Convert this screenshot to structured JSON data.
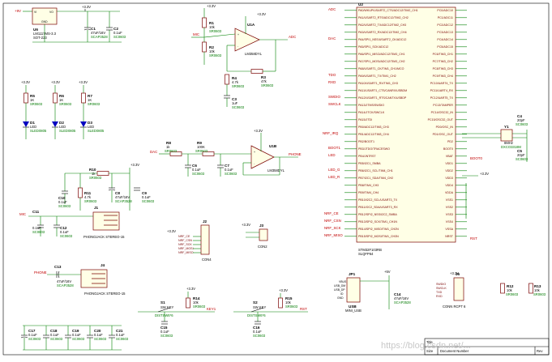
{
  "power": {
    "vin": "+9V",
    "v33": "+3.3V",
    "v5": "+5V"
  },
  "regulator": {
    "ref": "U6",
    "part": "LM1117MS-3.3",
    "package": "SOT-223",
    "pins": [
      "VI",
      "VO",
      "GND"
    ]
  },
  "caps": {
    "c1": {
      "ref": "C1",
      "value": "47uF/16V",
      "pkg": "SCAP3528"
    },
    "c2": {
      "ref": "C2",
      "value": "0.1uF",
      "pkg": "SC0603"
    },
    "c3": {
      "ref": "C3",
      "value": "1uF",
      "pkg": "SC0603"
    },
    "c4": {
      "ref": "C4",
      "value": "20pF",
      "pkg": "SC0603"
    },
    "c5": {
      "ref": "C5",
      "value": "20pF",
      "pkg": "SC0603"
    },
    "c6": {
      "ref": "C6",
      "value": "0.1uF",
      "pkg": "SC0603"
    },
    "c7": {
      "ref": "C7",
      "value": "0.1uF",
      "pkg": "SC0603"
    },
    "c8": {
      "ref": "C8",
      "value": "47uF/16V",
      "pkg": "SCAP3528"
    },
    "c9": {
      "ref": "C9",
      "value": "0.1uF",
      "pkg": "SC0603"
    },
    "c10": {
      "ref": "C10",
      "value": "0.1uF",
      "pkg": "SC0603"
    },
    "c11": {
      "ref": "C11",
      "value": "0.1uF",
      "pkg": "SC0603"
    },
    "c12": {
      "ref": "C12",
      "value": "0.1uF",
      "pkg": "SC0603"
    },
    "c13": {
      "ref": "C13",
      "value": "47uF/16V",
      "pkg": "SCAP3528"
    },
    "c14": {
      "ref": "C14",
      "value": "47uF/16V",
      "pkg": "SCAP3528"
    },
    "c15": {
      "ref": "C15",
      "value": "0.1uF",
      "pkg": "SC0603"
    },
    "c16": {
      "ref": "C16",
      "value": "0.1uF",
      "pkg": "SC0603"
    },
    "c17": {
      "ref": "C17",
      "value": "0.1uF",
      "pkg": "SC0603"
    },
    "c18": {
      "ref": "C18",
      "value": "0.1uF",
      "pkg": "SC0603"
    },
    "c19": {
      "ref": "C19",
      "value": "0.1uF",
      "pkg": "SC0603"
    },
    "c20": {
      "ref": "C20",
      "value": "0.1uF",
      "pkg": "SC0603"
    },
    "c21": {
      "ref": "C21",
      "value": "0.1uF",
      "pkg": "SC0603"
    }
  },
  "resistors": {
    "r1": {
      "ref": "R1",
      "value": "10k",
      "pkg": "SR0603"
    },
    "r2": {
      "ref": "R2",
      "value": "10k",
      "pkg": "SR0603"
    },
    "r3": {
      "ref": "R3",
      "value": "47k",
      "pkg": "SR0603"
    },
    "r4": {
      "ref": "R4",
      "value": "4.7k",
      "pkg": "SR0603"
    },
    "r5": {
      "ref": "R5",
      "value": "1K",
      "pkg": "SR0603"
    },
    "r6": {
      "ref": "R6",
      "value": "1K",
      "pkg": "SR0603"
    },
    "r7": {
      "ref": "R7",
      "value": "1K",
      "pkg": "SR0603"
    },
    "r8": {
      "ref": "R8",
      "value": "1k",
      "pkg": "SR0603"
    },
    "r9": {
      "ref": "R9",
      "value": "100K",
      "pkg": "SR0603"
    },
    "r10": {
      "ref": "R10",
      "value": "1k",
      "pkg": "SR0603"
    },
    "r11": {
      "ref": "R11",
      "value": "4.7k",
      "pkg": "SR0603"
    },
    "r12": {
      "ref": "R12",
      "value": "10k",
      "pkg": "SR0603"
    },
    "r13": {
      "ref": "R13",
      "value": "10k",
      "pkg": "SR0603"
    },
    "r14": {
      "ref": "R14",
      "value": "10k",
      "pkg": "SR0603"
    },
    "r15": {
      "ref": "R15",
      "value": "10k",
      "pkg": "SR0603"
    }
  },
  "leds": {
    "d1": {
      "ref": "D1",
      "label": "LED",
      "pkg": "SLED0805"
    },
    "d2": {
      "ref": "D2",
      "label": "LED",
      "pkg": "SLED0805"
    },
    "d3": {
      "ref": "D3",
      "label": "LED",
      "pkg": "SLED0805"
    }
  },
  "opamps": {
    "u1a": {
      "ref": "U1A",
      "part": "LM358DYL"
    },
    "u1b": {
      "ref": "U1B",
      "part": "LM358DYL"
    }
  },
  "jacks": {
    "j1": {
      "ref": "J1",
      "part": "PHONOJACK STEREO-15"
    },
    "j4": {
      "ref": "J4",
      "part": "PHONOJACK STEREO-15"
    }
  },
  "connectors": {
    "j2": {
      "ref": "J2",
      "part": "CON4"
    },
    "j3": {
      "ref": "J3",
      "part": "CON2"
    },
    "j5": {
      "ref": "J5",
      "part": "CONN RCPT 6"
    },
    "jp1": {
      "ref": "JP1",
      "part": "MINI_USB",
      "usb_ref": "USB"
    }
  },
  "switches": {
    "s1": {
      "ref": "S1",
      "part": "SW KEY",
      "pkg": "DISTSW6*6"
    },
    "s2": {
      "ref": "S2",
      "part": "SW KEY",
      "pkg": "DISTSW6*6"
    }
  },
  "crystal": {
    "ref": "Y1",
    "value": "8MHz",
    "pkg": "DXCO3318M"
  },
  "mcu": {
    "ref": "U2",
    "part": "STM32F103RB",
    "package": "SLQFP64",
    "left_pins": [
      "PA0/WKUP/USART2_CTS/ADC12/TIM2_CH1",
      "PA1/USART2_RTS/ADC12/TIM2_CH2",
      "PA2/USART2_TX/ADC12/TIM2_CH3",
      "PA3/USART2_RX/ADC12/TIM2_CH4",
      "PA4/SPI1_NSS/USART2_CK/ADC12",
      "PA5/SPI1_SCK/ADC12",
      "PA6/SPI1_MISO/ADC12/TIM3_CH1",
      "PA7/SPI1_MOSI/ADC12/TIM3_CH2",
      "PA8/USART1_CK/TIM1_CH1/MCO",
      "PA9/USART1_TX/TIM1_CH2",
      "PA10/USART1_RX/TIM1_CH3",
      "PA11/USART1_CTS/CANRX/USBDM",
      "PA12/USART1_RTS/CANTX/USBDP",
      "PA13/JTMS/SWDIO",
      "PA14/JTCK/SWCLK",
      "PA15/JTDI",
      "PB0/ADC12/TIM3_CH3",
      "PB1/ADC12/TIM3_CH4",
      "PB2/BOOT1",
      "PB3/JTDO/TRACESWO",
      "PB4/JNTRST",
      "PB5/I2C1_SMBA",
      "PB6/I2C1_SCL/TIM4_CH1",
      "PB7/I2C1_SDA/TIM4_CH2",
      "PB8/TIM4_CH3",
      "PB9/TIM4_CH4",
      "PB10/I2C2_SCL/USART3_TX",
      "PB11/I2C2_SDA/USART3_RX",
      "PB12/SPI2_NSS/I2C2_SMBA",
      "PB13/SPI2_SCK/TIM1_CH1N",
      "PB14/SPI2_MISO/TIM1_CH2N",
      "PB15/SPI2_MOSI/TIM1_CH3N"
    ],
    "right_pins": [
      "PC0/ADC10",
      "PC1/ADC11",
      "PC2/ADC12",
      "PC3/ADC13",
      "PC4/ADC14",
      "PC5/ADC15",
      "PC6/TIM3_CH1",
      "PC7/TIM3_CH2",
      "PC8/TIM3_CH3",
      "PC9/TIM3_CH4",
      "PC10/UART4_TX",
      "PC11/UART4_RX",
      "PC12/UART5_TX",
      "PC13/TAMPER",
      "PC14/OSC32_IN",
      "PC15/OSC32_OUT",
      "PD0/OSC_IN",
      "PD1/OSC_OUT",
      "PD2",
      "BOOT0",
      "VBAT",
      "VDD1",
      "VDD2",
      "VDD3",
      "VDD4",
      "VDDA",
      "VSS1",
      "VSS2",
      "VSS3",
      "VSS4",
      "VSSA",
      "NRST"
    ]
  },
  "nets": {
    "vin_tag": "+9V",
    "adc": "ADC",
    "dac": "DAC",
    "phone": "PHONE",
    "mic": "MIC",
    "tdo": "TDO",
    "rxd": "RXD",
    "txd": "TXD",
    "swdio": "SWDIO",
    "swclk": "SWCLK",
    "nrf_irq": "NRF_IRQ",
    "boot1": "BOOT1",
    "boot0": "BOOT0",
    "led": "LED",
    "led_r": "LED_R",
    "led_g": "LED_G",
    "nrf_ce": "NRF_CE",
    "nrf_csn": "NRF_CSN",
    "nrf_sck": "NRF_SCK",
    "nrf_miso": "NRF_MISO",
    "nrf_mosi": "NRF_MOSI",
    "rst": "RST",
    "key": "KEY1",
    "osc_in": "OSC_IN",
    "osc_out": "OSC_OUT",
    "usb_dm": "USB_DM",
    "usb_dp": "USB_DP",
    "usb_vbus": "VBUS",
    "usb_gnd": "GND",
    "usb_id": "ID",
    "txd0": "TXD0",
    "rxd0": "RXD0"
  },
  "title_block": {
    "size": "Size",
    "docnum": "Document Number",
    "rev": "Rev",
    "title": "Title"
  },
  "watermark": "https://blog.csdn.net/..."
}
